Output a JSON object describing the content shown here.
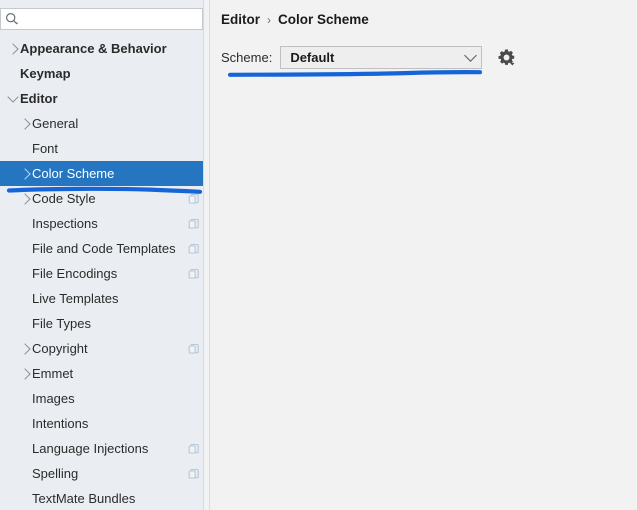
{
  "search": {
    "placeholder": "",
    "value": "",
    "icon": "search-icon"
  },
  "sidebar": {
    "items": [
      {
        "label": "Appearance & Behavior",
        "depth": 0,
        "bold": true,
        "arrow": "right",
        "scope_icon": false,
        "selected": false
      },
      {
        "label": "Keymap",
        "depth": 0,
        "bold": true,
        "arrow": "none",
        "scope_icon": false,
        "selected": false
      },
      {
        "label": "Editor",
        "depth": 0,
        "bold": true,
        "arrow": "down",
        "scope_icon": false,
        "selected": false
      },
      {
        "label": "General",
        "depth": 1,
        "bold": false,
        "arrow": "right",
        "scope_icon": false,
        "selected": false
      },
      {
        "label": "Font",
        "depth": 1,
        "bold": false,
        "arrow": "none",
        "scope_icon": false,
        "selected": false
      },
      {
        "label": "Color Scheme",
        "depth": 1,
        "bold": false,
        "arrow": "right",
        "scope_icon": false,
        "selected": true
      },
      {
        "label": "Code Style",
        "depth": 1,
        "bold": false,
        "arrow": "right",
        "scope_icon": true,
        "selected": false
      },
      {
        "label": "Inspections",
        "depth": 1,
        "bold": false,
        "arrow": "none",
        "scope_icon": true,
        "selected": false
      },
      {
        "label": "File and Code Templates",
        "depth": 1,
        "bold": false,
        "arrow": "none",
        "scope_icon": true,
        "selected": false
      },
      {
        "label": "File Encodings",
        "depth": 1,
        "bold": false,
        "arrow": "none",
        "scope_icon": true,
        "selected": false
      },
      {
        "label": "Live Templates",
        "depth": 1,
        "bold": false,
        "arrow": "none",
        "scope_icon": false,
        "selected": false
      },
      {
        "label": "File Types",
        "depth": 1,
        "bold": false,
        "arrow": "none",
        "scope_icon": false,
        "selected": false
      },
      {
        "label": "Copyright",
        "depth": 1,
        "bold": false,
        "arrow": "right",
        "scope_icon": true,
        "selected": false
      },
      {
        "label": "Emmet",
        "depth": 1,
        "bold": false,
        "arrow": "right",
        "scope_icon": false,
        "selected": false
      },
      {
        "label": "Images",
        "depth": 1,
        "bold": false,
        "arrow": "none",
        "scope_icon": false,
        "selected": false
      },
      {
        "label": "Intentions",
        "depth": 1,
        "bold": false,
        "arrow": "none",
        "scope_icon": false,
        "selected": false
      },
      {
        "label": "Language Injections",
        "depth": 1,
        "bold": false,
        "arrow": "none",
        "scope_icon": true,
        "selected": false
      },
      {
        "label": "Spelling",
        "depth": 1,
        "bold": false,
        "arrow": "none",
        "scope_icon": true,
        "selected": false
      },
      {
        "label": "TextMate Bundles",
        "depth": 1,
        "bold": false,
        "arrow": "none",
        "scope_icon": false,
        "selected": false
      }
    ]
  },
  "content": {
    "breadcrumb": {
      "root": "Editor",
      "separator": "›",
      "current": "Color Scheme"
    },
    "scheme": {
      "label": "Scheme:",
      "value": "Default",
      "options": [
        "Default"
      ],
      "gear_icon": "gear-with-dropdown-icon",
      "chevron_icon": "chevron-down-icon"
    }
  },
  "annotations": {
    "color": "#1565D8",
    "marks": [
      {
        "name": "sidebar-underline"
      },
      {
        "name": "scheme-underline"
      }
    ]
  },
  "colors": {
    "selection": "#2675c0",
    "sidebar_bg": "#eaeef2",
    "panel_bg": "#f2f2f2",
    "annotation": "#1565D8"
  }
}
